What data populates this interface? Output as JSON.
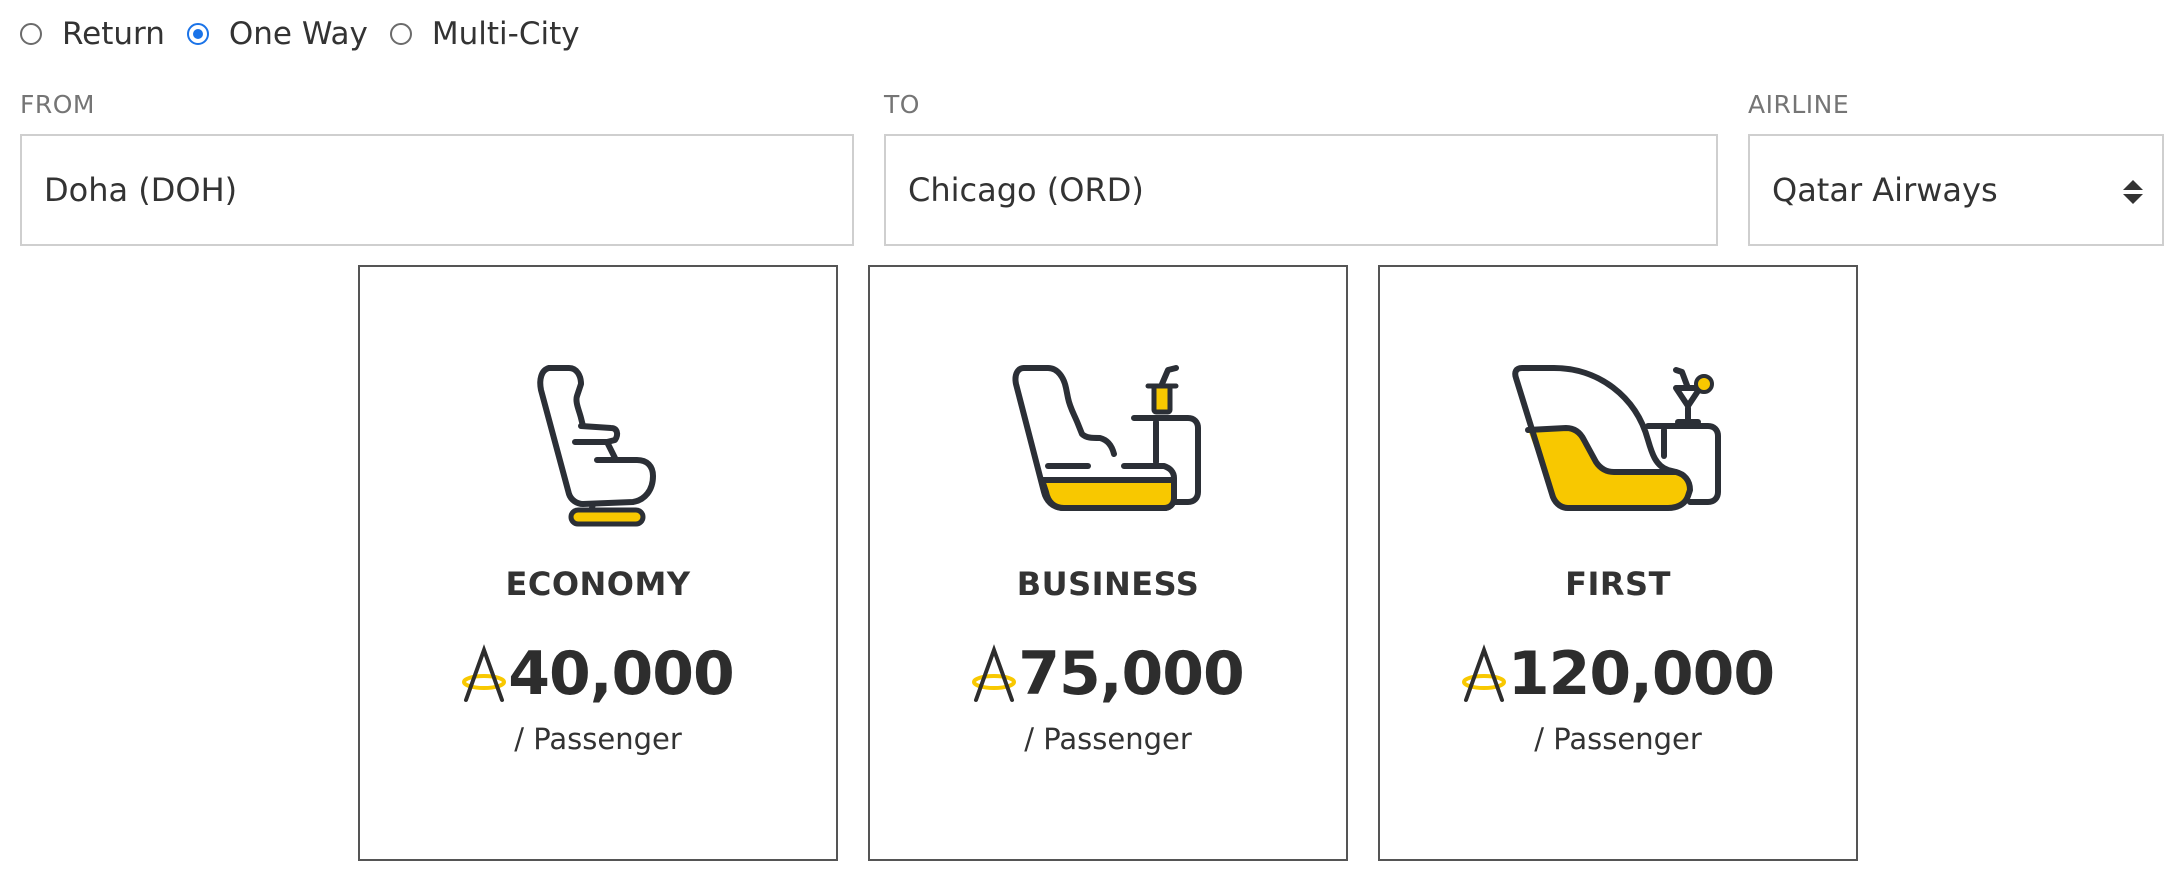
{
  "trip_types": [
    {
      "label": "Return",
      "checked": false
    },
    {
      "label": "One Way",
      "checked": true
    },
    {
      "label": "Multi-City",
      "checked": false
    }
  ],
  "from": {
    "label": "FROM",
    "value": "Doha (DOH)"
  },
  "to": {
    "label": "TO",
    "value": "Chicago (ORD)"
  },
  "airline": {
    "label": "AIRLINE",
    "value": "Qatar Airways"
  },
  "fares": [
    {
      "cabin": "ECONOMY",
      "price": "40,000",
      "unit": "/ Passenger",
      "icon": "economy-seat-icon"
    },
    {
      "cabin": "BUSINESS",
      "price": "75,000",
      "unit": "/ Passenger",
      "icon": "business-seat-icon"
    },
    {
      "cabin": "FIRST",
      "price": "120,000",
      "unit": "/ Passenger",
      "icon": "first-seat-icon"
    }
  ],
  "colors": {
    "accent_yellow": "#f8c800",
    "icon_stroke": "#2b2f36",
    "radio_checked": "#1a73e8"
  }
}
